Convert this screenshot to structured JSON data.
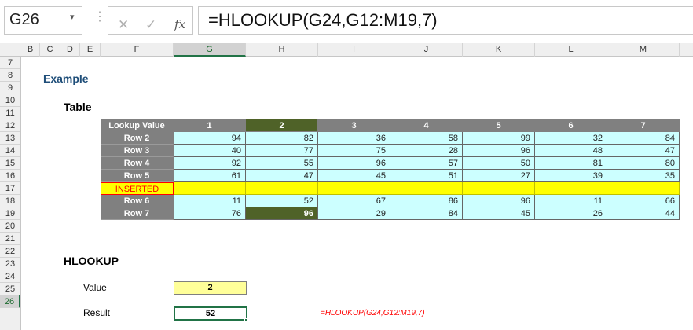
{
  "namebox": {
    "value": "G26",
    "arrow": "▾"
  },
  "formula_bar": {
    "separator": "⋮",
    "cancel": "✕",
    "enter": "✓",
    "fx": "fx",
    "formula": "=HLOOKUP(G24,G12:M19,7)"
  },
  "columns": [
    "B",
    "C",
    "D",
    "E",
    "F",
    "G",
    "H",
    "I",
    "J",
    "K",
    "L",
    "M"
  ],
  "selected_column": "G",
  "rows": [
    "7",
    "8",
    "9",
    "10",
    "11",
    "12",
    "13",
    "14",
    "15",
    "16",
    "17",
    "18",
    "19",
    "20",
    "21",
    "22",
    "23",
    "24",
    "25",
    "26"
  ],
  "selected_row": "26",
  "sheet": {
    "title": "Example",
    "table_heading": "Table",
    "hlookup_heading": "HLOOKUP",
    "value_label": "Value",
    "result_label": "Result"
  },
  "table": {
    "corner": "Lookup Value",
    "headers": [
      "1",
      "2",
      "3",
      "4",
      "5",
      "6",
      "7"
    ],
    "selected_header_index": 1,
    "rows": [
      {
        "label": "Row 2",
        "values": [
          "94",
          "82",
          "36",
          "58",
          "99",
          "32",
          "84"
        ]
      },
      {
        "label": "Row 3",
        "values": [
          "40",
          "77",
          "75",
          "28",
          "96",
          "48",
          "47"
        ]
      },
      {
        "label": "Row 4",
        "values": [
          "92",
          "55",
          "96",
          "57",
          "50",
          "81",
          "80"
        ]
      },
      {
        "label": "Row 5",
        "values": [
          "61",
          "47",
          "45",
          "51",
          "27",
          "39",
          "35"
        ]
      },
      {
        "label": "INSERTED",
        "values": [
          "",
          "",
          "",
          "",
          "",
          "",
          ""
        ],
        "inserted": true
      },
      {
        "label": "Row 6",
        "values": [
          "11",
          "52",
          "67",
          "86",
          "96",
          "11",
          "66"
        ]
      },
      {
        "label": "Row 7",
        "values": [
          "76",
          "96",
          "29",
          "84",
          "45",
          "26",
          "44"
        ],
        "selected_index": 1
      }
    ]
  },
  "lookup": {
    "value": "2",
    "result": "52",
    "formula_text": "=HLOOKUP(G24,G12:M19,7)"
  },
  "colors": {
    "header_gray": "#808080",
    "highlight_green": "#4f6228",
    "data_cyan": "#ccffff",
    "inserted_yellow": "#ffff00",
    "value_yellow": "#ffff99",
    "excel_green": "#217346"
  }
}
